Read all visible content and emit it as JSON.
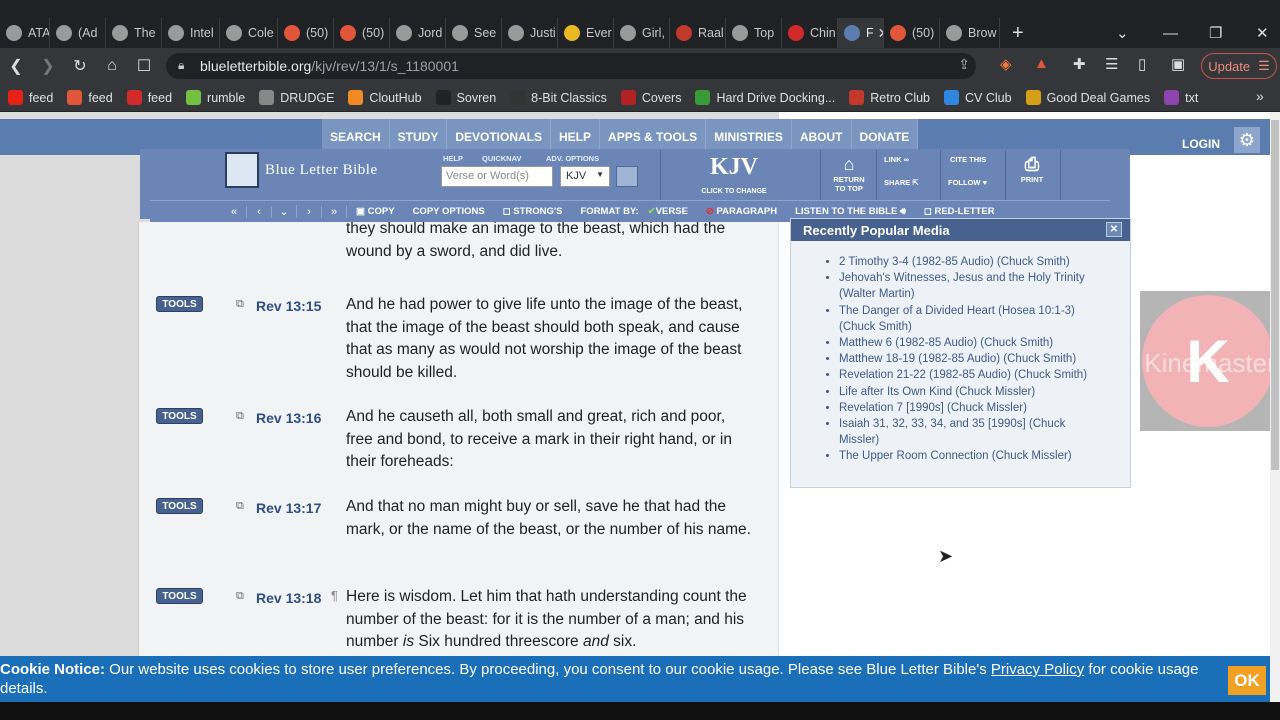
{
  "browser": {
    "tabs": [
      {
        "title": "ATA",
        "icon": "atari-icon"
      },
      {
        "title": "(Ad",
        "icon": "globe-icon"
      },
      {
        "title": "The",
        "icon": "bookmark-icon"
      },
      {
        "title": "Intel",
        "icon": "android-icon"
      },
      {
        "title": "Cole",
        "icon": "library-icon"
      },
      {
        "title": "(50)",
        "icon": "reddit-icon"
      },
      {
        "title": "(50)",
        "icon": "reddit-icon"
      },
      {
        "title": "Jord",
        "icon": "chrome-icon"
      },
      {
        "title": "See",
        "icon": "chrome-icon"
      },
      {
        "title": "Justi",
        "icon": "s-logo-icon"
      },
      {
        "title": "Ever",
        "icon": "emoji-icon"
      },
      {
        "title": "Girl,",
        "icon": "chrome-icon"
      },
      {
        "title": "Raal",
        "icon": "pin-icon"
      },
      {
        "title": "Top",
        "icon": "chrome-icon"
      },
      {
        "title": "Chin",
        "icon": "news-icon"
      },
      {
        "title": "F",
        "icon": "blb-icon"
      },
      {
        "title": "(50)",
        "icon": "reddit-icon"
      },
      {
        "title": "Brow",
        "icon": "nf-icon"
      }
    ],
    "url_host": "blueletterbible.org",
    "url_path": "/kjv/rev/13/1/s_1180001",
    "update_label": "Update",
    "bookmarks": [
      {
        "label": "feed",
        "color": "#e62117"
      },
      {
        "label": "feed",
        "color": "#e0563b"
      },
      {
        "label": "feed",
        "color": "#d12a2a"
      },
      {
        "label": "rumble",
        "color": "#74c044"
      },
      {
        "label": "DRUDGE",
        "color": "#888888"
      },
      {
        "label": "CloutHub",
        "color": "#f08a24"
      },
      {
        "label": "Sovren",
        "color": "#222222"
      },
      {
        "label": "8-Bit Classics",
        "color": "#333333"
      },
      {
        "label": "Covers",
        "color": "#b22222"
      },
      {
        "label": "Hard Drive Docking...",
        "color": "#3a9a3a"
      },
      {
        "label": "Retro Club",
        "color": "#c0392b"
      },
      {
        "label": "CV Club",
        "color": "#2e86de"
      },
      {
        "label": "Good Deal Games",
        "color": "#d4a017"
      },
      {
        "label": "txt",
        "color": "#8e44ad"
      }
    ]
  },
  "site": {
    "nav": [
      "SEARCH",
      "STUDY",
      "DEVOTIONALS",
      "HELP",
      "APPS & TOOLS",
      "MINISTRIES",
      "ABOUT",
      "DONATE"
    ],
    "login": "LOGIN",
    "logo_text": "Blue Letter Bible",
    "labels": {
      "help": "HELP",
      "quicknav": "QUICKNAV",
      "adv": "ADV. OPTIONS"
    },
    "search_placeholder": "Verse or Word(s)",
    "version": "KJV",
    "kjv_title": "KJV",
    "kjv_sub": "CLICK TO CHANGE",
    "return_top": "RETURN TO TOP",
    "link": "LINK",
    "share": "SHARE",
    "cite": "CITE THIS",
    "follow": "FOLLOW",
    "print": "PRINT",
    "toolbar": {
      "copy": "COPY",
      "copy_options": "COPY OPTIONS",
      "strongs": "STRONG'S",
      "format_by": "FORMAT BY:",
      "verse": "VERSE",
      "paragraph": "PARAGRAPH",
      "listen": "LISTEN TO THE BIBLE",
      "red_letter": "RED-LETTER"
    }
  },
  "verses": [
    {
      "tools": "",
      "ref": "",
      "text": "they should make an image to the beast, which had the wound by a sword, and did live."
    },
    {
      "tools": "TOOLS",
      "ref": "Rev 13:15",
      "text": "And he had power to give life unto the image of the beast, that the image of the beast should both speak, and cause that as many as would not worship the image of the beast should be killed."
    },
    {
      "tools": "TOOLS",
      "ref": "Rev 13:16",
      "text": "And he causeth all, both small and great, rich and poor, free and bond, to receive a mark in their right hand, or in their foreheads:"
    },
    {
      "tools": "TOOLS",
      "ref": "Rev 13:17",
      "text": "And that no man might buy or sell, save he that had the mark, or the name of the beast, or the number of his name."
    },
    {
      "tools": "TOOLS",
      "ref": "Rev 13:18",
      "pilcrow": "¶",
      "text_a": "Here is wisdom. Let him that hath understanding count the number of the beast: for it is the number of a man; and his number ",
      "is": "is",
      "text_b": " Six hundred threescore ",
      "and": "and",
      "text_c": " six."
    }
  ],
  "media": {
    "title": "Recently Popular Media",
    "items": [
      "2 Timothy 3-4 (1982-85 Audio) (Chuck Smith)",
      "Jehovah's Witnesses, Jesus and the Holy Trinity (Walter Martin)",
      "The Danger of a Divided Heart (Hosea 10:1-3) (Chuck Smith)",
      "Matthew 6 (1982-85 Audio) (Chuck Smith)",
      "Matthew 18-19 (1982-85 Audio) (Chuck Smith)",
      "Revelation 21-22 (1982-85 Audio) (Chuck Smith)",
      "Life after Its Own Kind (Chuck Missler)",
      "Revelation 7 [1990s] (Chuck Missler)",
      "Isaiah 31, 32, 33, 34, and 35 [1990s] (Chuck Missler)",
      "The Upper Room Connection (Chuck Missler)"
    ]
  },
  "watermark": {
    "letter": "K",
    "text": "Kinemaster"
  },
  "cookie": {
    "label": "Cookie Notice:",
    "text": " Our website uses cookies to store user preferences. By proceeding, you consent to our cookie usage. Please see Blue Letter Bible's ",
    "link": "Privacy Policy",
    "tail": " for cookie usage details.",
    "ok": "OK"
  }
}
